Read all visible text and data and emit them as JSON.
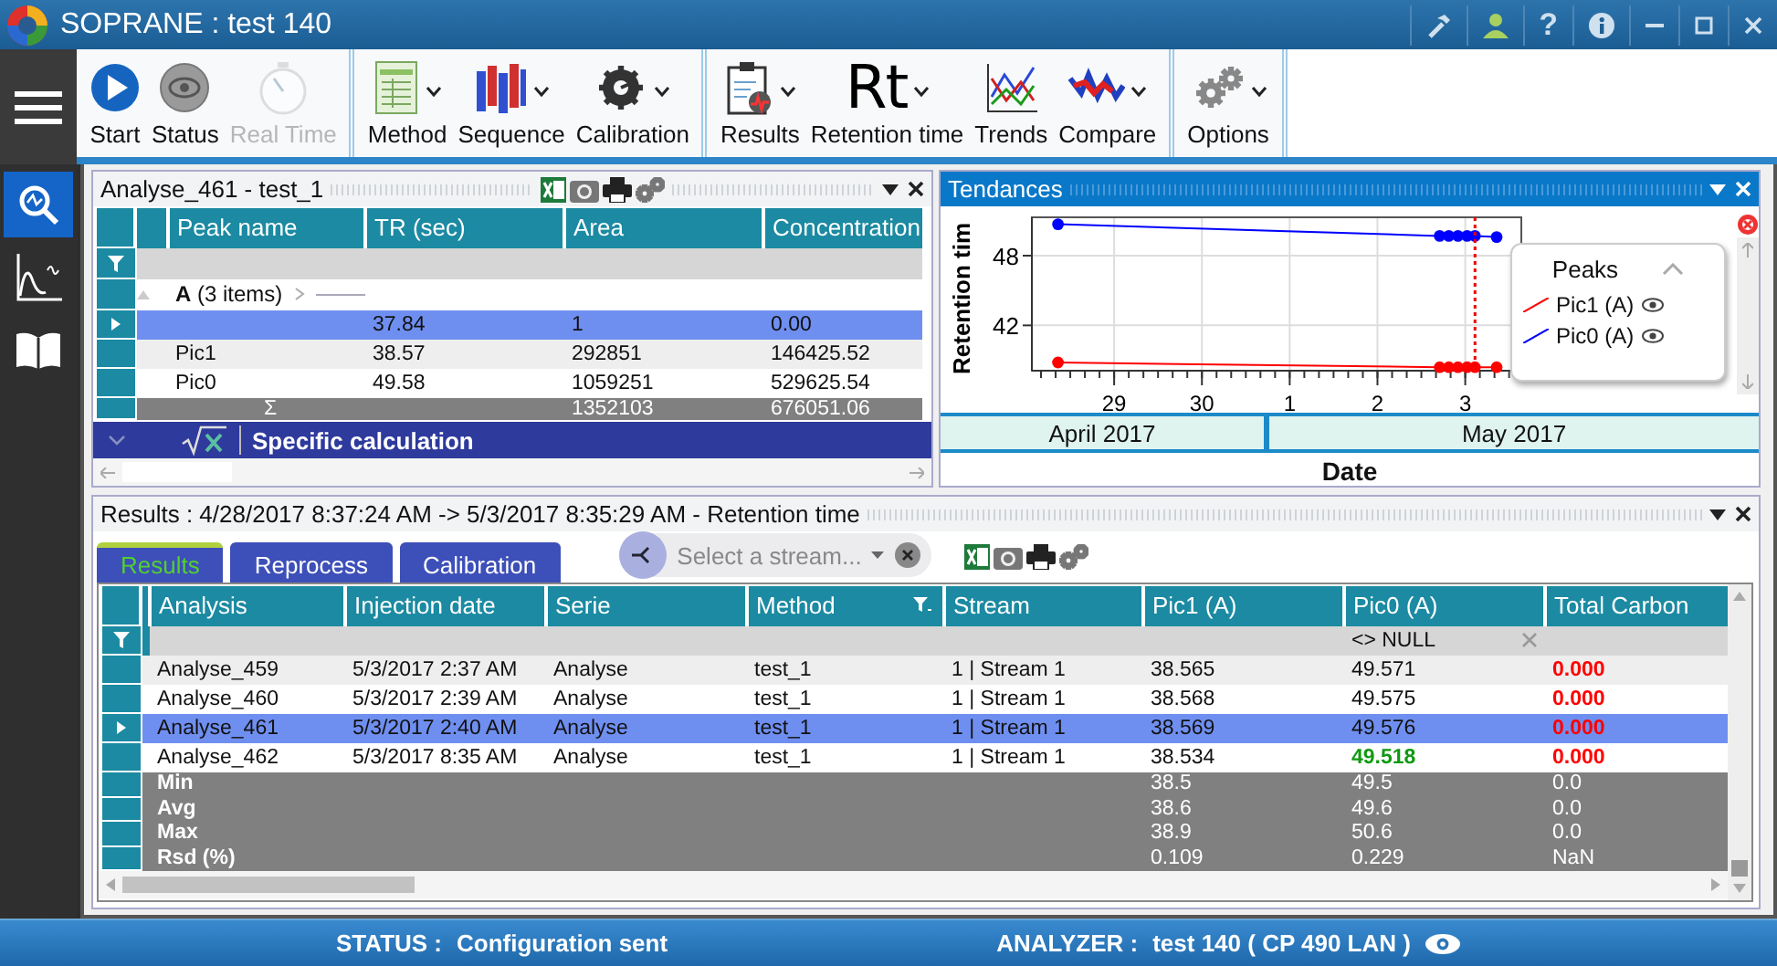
{
  "window": {
    "title": "SOPRANE : test 140",
    "help": "?"
  },
  "ribbon": {
    "groups": [
      {
        "buttons": [
          {
            "label": "Start",
            "disabled": false,
            "dropdown": false
          },
          {
            "label": "Status",
            "disabled": false,
            "dropdown": false
          },
          {
            "label": "Real Time",
            "disabled": true,
            "dropdown": false
          }
        ]
      },
      {
        "buttons": [
          {
            "label": "Method",
            "disabled": false,
            "dropdown": true
          },
          {
            "label": "Sequence",
            "disabled": false,
            "dropdown": true
          },
          {
            "label": "Calibration",
            "disabled": false,
            "dropdown": true
          }
        ]
      },
      {
        "buttons": [
          {
            "label": "Results",
            "disabled": false,
            "dropdown": true
          },
          {
            "label": "Retention time",
            "glyph": "Rt",
            "disabled": false,
            "dropdown": true
          },
          {
            "label": "Trends",
            "disabled": false,
            "dropdown": false
          },
          {
            "label": "Compare",
            "disabled": false,
            "dropdown": true
          }
        ]
      },
      {
        "buttons": [
          {
            "label": "Options",
            "disabled": false,
            "dropdown": true
          }
        ]
      }
    ]
  },
  "sidebar": {
    "items": [
      {
        "selected": true
      },
      {
        "selected": false
      },
      {
        "selected": false
      }
    ]
  },
  "peak_panel": {
    "title": "Analyse_461 - test_1",
    "columns": [
      "Peak name",
      "TR (sec)",
      "Area",
      "Concentration"
    ],
    "group": {
      "label": "**A** (3 items)"
    },
    "rows": [
      {
        "selected": true,
        "cells": [
          "",
          "37.84",
          "1",
          "0.00"
        ]
      },
      {
        "selected": false,
        "cells": [
          "Pic1",
          "38.57",
          "292851",
          "146425.52"
        ]
      },
      {
        "selected": false,
        "cells": [
          "Pic0",
          "49.58",
          "1059251",
          "529625.54"
        ]
      }
    ],
    "total": {
      "symbol": "Σ",
      "cells": [
        "",
        "1352103",
        "676051.06"
      ]
    },
    "calc_section": {
      "label": "Specific calculation"
    }
  },
  "trends_panel": {
    "title": "Tendances",
    "chart_data": {
      "type": "line",
      "grid": true,
      "ylabel": "Retention tim",
      "xlabel": "Date",
      "x": [
        "2017-04-28T08:37:00Z",
        "2017-05-02T17:00:00Z",
        "2017-05-02T19:30:00Z",
        "2017-05-02T22:00:00Z",
        "2017-05-03T00:30:00Z",
        "2017-05-03T02:40:00Z",
        "2017-05-03T08:35:00Z"
      ],
      "xlim": [
        "2017-04-28T01:30:00Z",
        "2017-05-03T15:20:00Z"
      ],
      "ylim": [
        38.1,
        51.3
      ],
      "xticks": [
        {
          "value": "2017-04-29T00:00:00Z",
          "label": "29"
        },
        {
          "value": "2017-04-30T00:00:00Z",
          "label": "30"
        },
        {
          "value": "2017-05-01T00:00:00Z",
          "label": "1"
        },
        {
          "value": "2017-05-02T00:00:00Z",
          "label": "2"
        },
        {
          "value": "2017-05-03T00:00:00Z",
          "label": "3"
        }
      ],
      "yticks": [
        42,
        48
      ],
      "series": [
        {
          "name": "Pic1 (A)",
          "color": "#ff0000",
          "marker": "circle",
          "values": [
            38.8,
            38.4,
            38.4,
            38.4,
            38.4,
            38.4,
            38.4
          ]
        },
        {
          "name": "Pic0 (A)",
          "color": "#0000ff",
          "marker": "circle",
          "values": [
            50.7,
            49.7,
            49.7,
            49.7,
            49.7,
            49.7,
            49.6
          ]
        }
      ],
      "ref_lines": [
        {
          "axis": "x",
          "value": "2017-05-03T02:40:00Z",
          "color": "#ee0000"
        }
      ]
    },
    "legend": {
      "title": "Peaks"
    },
    "months": [
      "April 2017",
      "May 2017"
    ]
  },
  "results_panel": {
    "title": "Results : 4/28/2017 8:37:24 AM -> 5/3/2017 8:35:29 AM - Retention time",
    "tabs": [
      {
        "label": "Results",
        "selected": true
      },
      {
        "label": "Reprocess",
        "selected": false
      },
      {
        "label": "Calibration",
        "selected": false
      }
    ],
    "stream_select": {
      "placeholder": "Select a stream..."
    },
    "columns": [
      {
        "label": "Analysis",
        "filtered": false
      },
      {
        "label": "Injection date",
        "filtered": false
      },
      {
        "label": "Serie",
        "filtered": false
      },
      {
        "label": "Method",
        "filtered": true
      },
      {
        "label": "Stream",
        "filtered": false
      },
      {
        "label": "Pic1 (A)",
        "filtered": false
      },
      {
        "label": "Pic0 (A)",
        "filtered": false,
        "filter": "<> NULL"
      },
      {
        "label": "Total Carbon",
        "filtered": false
      }
    ],
    "rows": [
      {
        "selected": false,
        "cells": [
          "Analyse_459",
          "5/3/2017 2:37 AM",
          "Analyse",
          "test_1",
          "1 | Stream 1",
          "38.565",
          "49.571",
          {
            "text": "0.000",
            "color": "#ff0000"
          }
        ]
      },
      {
        "selected": false,
        "cells": [
          "Analyse_460",
          "5/3/2017 2:39 AM",
          "Analyse",
          "test_1",
          "1 | Stream 1",
          "38.568",
          "49.575",
          {
            "text": "0.000",
            "color": "#ff0000"
          }
        ]
      },
      {
        "selected": true,
        "cells": [
          "Analyse_461",
          "5/3/2017 2:40 AM",
          "Analyse",
          "test_1",
          "1 | Stream 1",
          "38.569",
          "49.576",
          {
            "text": "0.000",
            "color": "#ff0000"
          }
        ]
      },
      {
        "selected": false,
        "cells": [
          "Analyse_462",
          "5/3/2017 8:35 AM",
          "Analyse",
          "test_1",
          "1 | Stream 1",
          "38.534",
          {
            "text": "49.518",
            "color": "#119911"
          },
          {
            "text": "0.000",
            "color": "#ff0000"
          }
        ]
      }
    ],
    "summary": [
      {
        "label": "Min",
        "values": [
          "38.5",
          "49.5",
          "0.0"
        ]
      },
      {
        "label": "Avg",
        "values": [
          "38.6",
          "49.6",
          "0.0"
        ]
      },
      {
        "label": "Max",
        "values": [
          "38.9",
          "50.6",
          "0.0"
        ]
      },
      {
        "label": "Rsd (%)",
        "values": [
          "0.109",
          "0.229",
          "NaN"
        ]
      }
    ]
  },
  "status_bar": {
    "status_label": "STATUS :",
    "status": "Configuration sent",
    "analyzer_label": "ANALYZER :",
    "analyzer": "test 140 ( CP 490 LAN )"
  }
}
